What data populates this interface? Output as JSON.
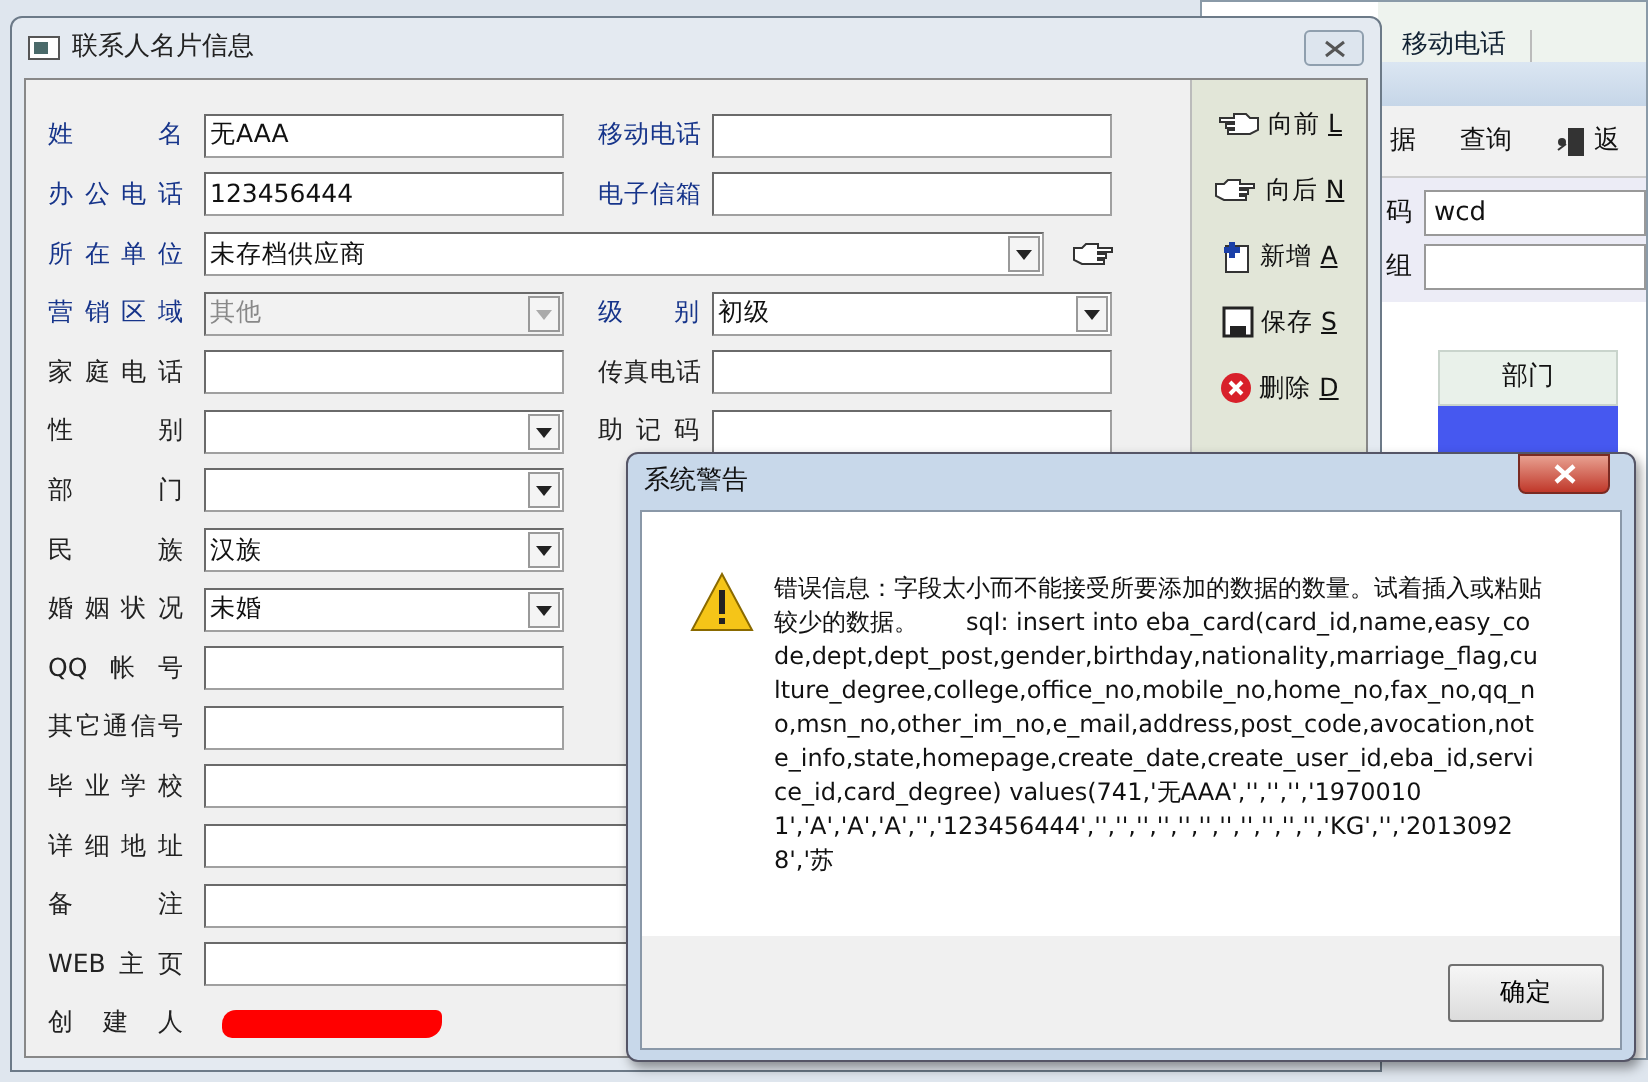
{
  "background_window": {
    "header_columns": [
      "移动电话"
    ],
    "toolbar": [
      {
        "label": "据",
        "kind": "plain"
      },
      {
        "label": "查询",
        "kind": "plain"
      },
      {
        "label": "返",
        "kind": "exit"
      }
    ],
    "fields": [
      {
        "label": "码",
        "value": "wcd"
      },
      {
        "label": "组"
      }
    ],
    "table": {
      "columns": [
        "部门"
      ],
      "rows": [
        {
          "selected": true
        }
      ]
    }
  },
  "dialog": {
    "title": "联系人名片信息",
    "rows": [
      {
        "left": {
          "label": "姓 名",
          "value": "无AAA",
          "kind": "text",
          "required": true
        },
        "right": {
          "label": "移动电话",
          "kind": "text",
          "required": true
        }
      },
      {
        "left": {
          "label": "办公电话",
          "value": "123456444",
          "kind": "text",
          "required": true
        },
        "right": {
          "label": "电子信箱",
          "kind": "text",
          "required": true
        }
      },
      {
        "left": {
          "label": "所在单位",
          "value": "未存档供应商",
          "kind": "combo-link",
          "required": true
        }
      },
      {
        "left": {
          "label": "营销区域",
          "value": "其他",
          "kind": "combo",
          "required": true,
          "disabled": true
        },
        "right": {
          "label": "级 别",
          "value": "初级",
          "kind": "combo",
          "required": true
        }
      },
      {
        "left": {
          "label": "家庭电话",
          "kind": "text"
        },
        "right": {
          "label": "传真电话",
          "kind": "text"
        }
      },
      {
        "left": {
          "label": "性 别",
          "kind": "combo"
        },
        "right": {
          "label": "助 记 码",
          "kind": "text"
        }
      },
      {
        "left": {
          "label": "部 门",
          "kind": "combo"
        }
      },
      {
        "left": {
          "label": "民 族",
          "value": "汉族",
          "kind": "combo"
        }
      },
      {
        "left": {
          "label": "婚姻状况",
          "value": "未婚",
          "kind": "combo"
        }
      },
      {
        "left": {
          "label": "QQ帐号",
          "kind": "text"
        }
      },
      {
        "left": {
          "label": "其它通信号",
          "kind": "text"
        }
      },
      {
        "left": {
          "label": "毕业学校",
          "kind": "text-wide"
        }
      },
      {
        "left": {
          "label": "详细地址",
          "kind": "text-wide"
        }
      },
      {
        "left": {
          "label": "备 注",
          "kind": "text-wide"
        }
      },
      {
        "left": {
          "label": "WEB主页",
          "kind": "text-wide"
        }
      },
      {
        "left": {
          "label": "创 建 人",
          "kind": "redacted"
        }
      }
    ],
    "side_buttons": [
      {
        "label": "向前",
        "key": "L",
        "kind": "prev"
      },
      {
        "label": "向后",
        "key": "N",
        "kind": "next"
      },
      {
        "label": "新增",
        "key": "A",
        "kind": "add"
      },
      {
        "label": "保存",
        "key": "S",
        "kind": "save"
      },
      {
        "label": "删除",
        "key": "D",
        "kind": "delete"
      }
    ]
  },
  "alert": {
    "title": "系统警告",
    "message": "错误信息：字段太小而不能接受所要添加的数据的数量。试着插入或粘贴较少的数据。　　sql: insert into eba_card(card_id,name,easy_code,dept,dept_post,gender,birthday,nationality,marriage_flag,culture_degree,college,office_no,mobile_no,home_no,fax_no,qq_no,msn_no,other_im_no,e_mail,address,post_code,avocation,note_info,state,homepage,create_date,create_user_id,eba_id,service_id,card_degree) values(741,'无AAA','','','','19700101','A','A','A','','123456444','','','','','','','','','','','','KG','','20130928','苏",
    "button": "确定"
  }
}
